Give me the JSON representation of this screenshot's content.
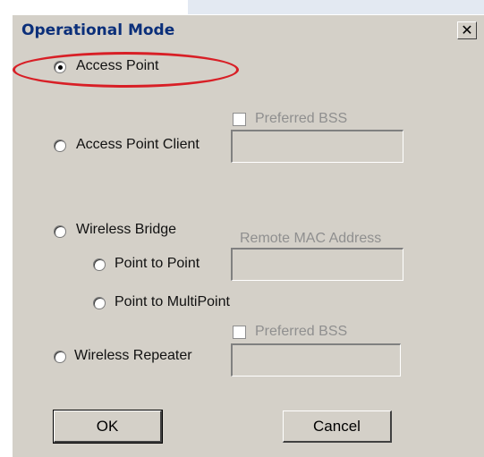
{
  "window": {
    "title": "Operational Mode",
    "close_glyph": "✕"
  },
  "modes": {
    "access_point": "Access Point",
    "access_point_client": "Access Point Client",
    "wireless_bridge": "Wireless Bridge",
    "point_to_point": "Point to Point",
    "point_to_multipoint": "Point to MultiPoint",
    "wireless_repeater": "Wireless Repeater",
    "selected": "access_point"
  },
  "client": {
    "preferred_bss_label": "Preferred BSS",
    "preferred_bss_checked": false,
    "bss_value": ""
  },
  "bridge": {
    "remote_mac_label": "Remote MAC Address",
    "remote_mac_value": ""
  },
  "repeater": {
    "preferred_bss_label": "Preferred BSS",
    "preferred_bss_checked": false,
    "bss_value": ""
  },
  "buttons": {
    "ok": "OK",
    "cancel": "Cancel"
  },
  "annotation": {
    "highlight_color": "#d81f26"
  },
  "colors": {
    "title_text": "#0b2f7a",
    "dialog_bg": "#d4d0c8"
  }
}
